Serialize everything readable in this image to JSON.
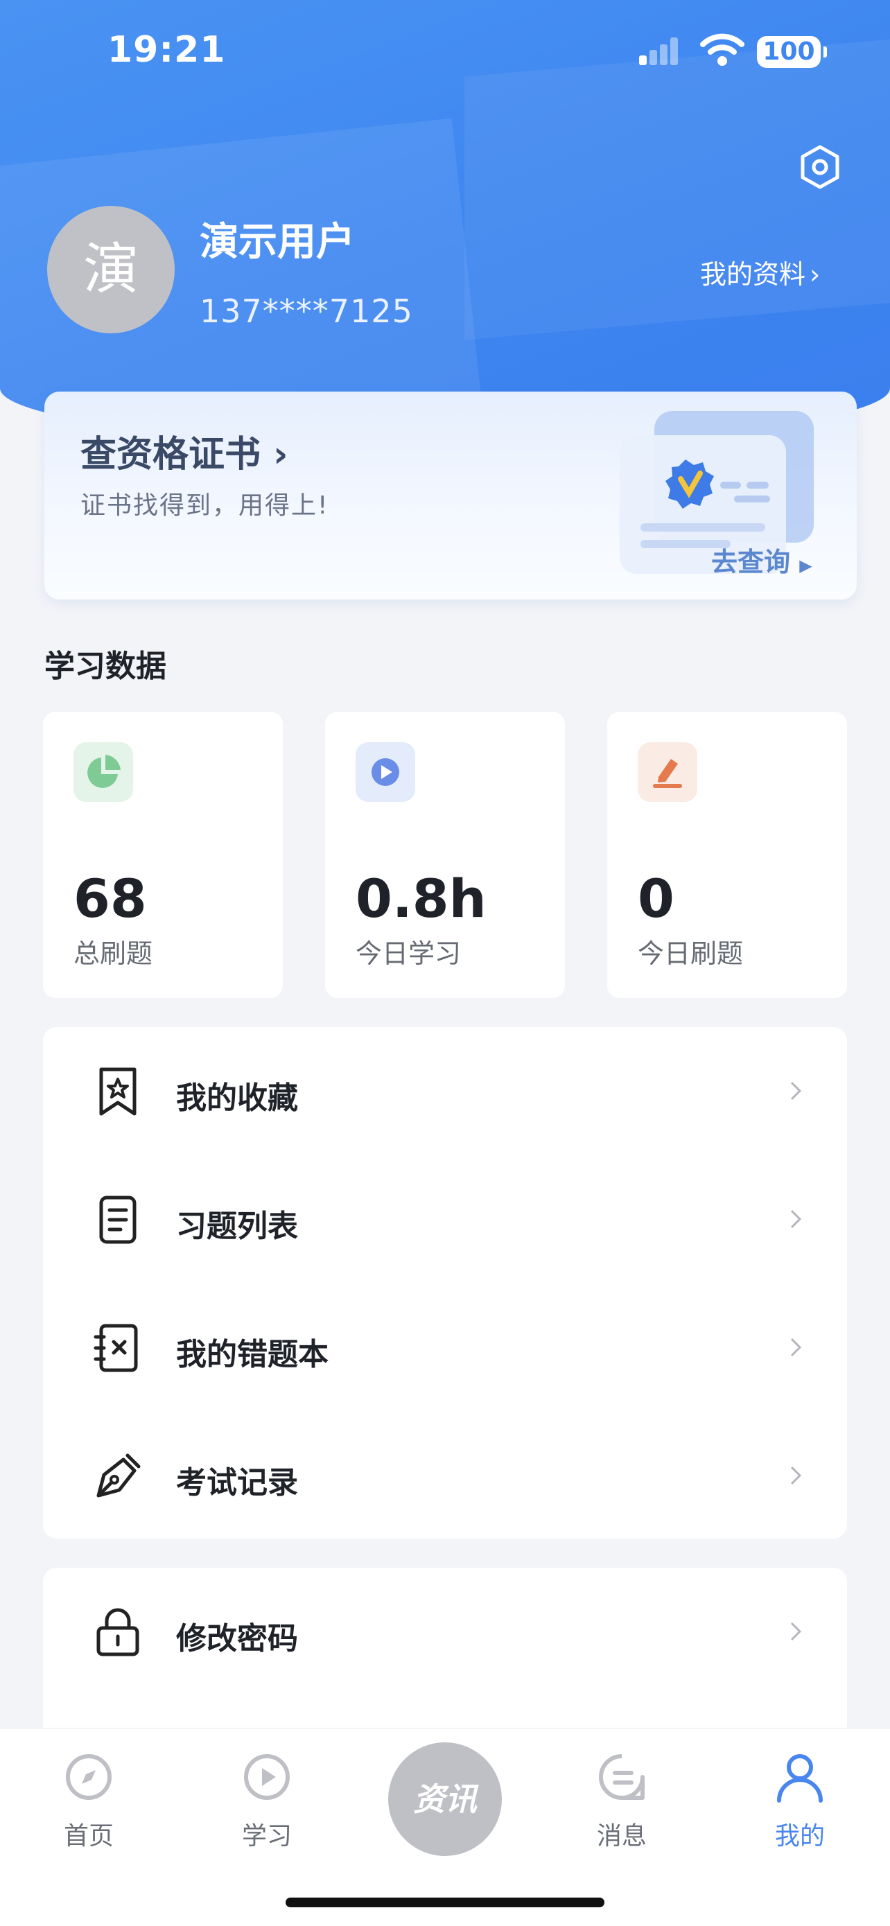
{
  "status_bar": {
    "time": "19:21",
    "battery": "100"
  },
  "user": {
    "avatar_char": "演",
    "name": "演示用户",
    "phone": "137****7125",
    "profile_link": "我的资料"
  },
  "cert_card": {
    "title": "查资格证书",
    "subtitle": "证书找得到，用得上!",
    "action": "去查询"
  },
  "study": {
    "title": "学习数据",
    "stats": [
      {
        "value": "68",
        "label": "总刷题"
      },
      {
        "value": "0.8h",
        "label": "今日学习"
      },
      {
        "value": "0",
        "label": "今日刷题"
      }
    ]
  },
  "menu": {
    "items": [
      {
        "label": "我的收藏",
        "icon": "bookmark-star-icon"
      },
      {
        "label": "习题列表",
        "icon": "document-list-icon"
      },
      {
        "label": "我的错题本",
        "icon": "wrong-notebook-icon"
      },
      {
        "label": "考试记录",
        "icon": "pen-nib-icon"
      }
    ],
    "security": {
      "label": "修改密码",
      "icon": "lock-icon"
    }
  },
  "tabbar": {
    "items": [
      {
        "label": "首页",
        "icon": "compass-icon"
      },
      {
        "label": "学习",
        "icon": "play-circle-icon"
      },
      {
        "label": "资讯",
        "icon": "news-icon"
      },
      {
        "label": "消息",
        "icon": "message-icon"
      },
      {
        "label": "我的",
        "icon": "user-icon"
      }
    ],
    "active": "我的"
  },
  "colors": {
    "primary": "#3e86f0",
    "active_tab": "#4a86f0",
    "stat_green": "#7ecb95",
    "stat_blue": "#6a8de8",
    "stat_orange": "#e47a4d"
  }
}
